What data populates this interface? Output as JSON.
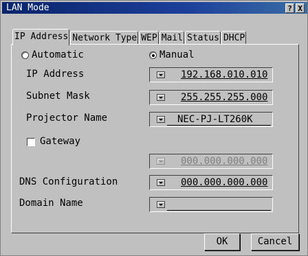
{
  "window": {
    "title": "LAN Mode",
    "help_label": "?",
    "close_label": "X"
  },
  "tabs": [
    {
      "label": "IP Address",
      "active": true
    },
    {
      "label": "Network Type",
      "active": false
    },
    {
      "label": "WEP",
      "active": false
    },
    {
      "label": "Mail",
      "active": false
    },
    {
      "label": "Status",
      "active": false
    },
    {
      "label": "DHCP",
      "active": false
    }
  ],
  "mode": {
    "automatic_label": "Automatic",
    "manual_label": "Manual",
    "selected": "Manual"
  },
  "fields": {
    "ip_address": {
      "label": "IP Address",
      "value": "192.168.010.010"
    },
    "subnet_mask": {
      "label": "Subnet Mask",
      "value": "255.255.255.000"
    },
    "projector_name": {
      "label": "Projector Name",
      "value": "NEC-PJ-LT260K"
    },
    "gateway": {
      "label": "Gateway",
      "checked": false,
      "value": "000.000.000.000"
    },
    "dns": {
      "label": "DNS Configuration",
      "value": "000.000.000.000"
    },
    "domain": {
      "label": "Domain Name",
      "value": ""
    }
  },
  "buttons": {
    "ok_label": "OK",
    "cancel_label": "Cancel"
  }
}
